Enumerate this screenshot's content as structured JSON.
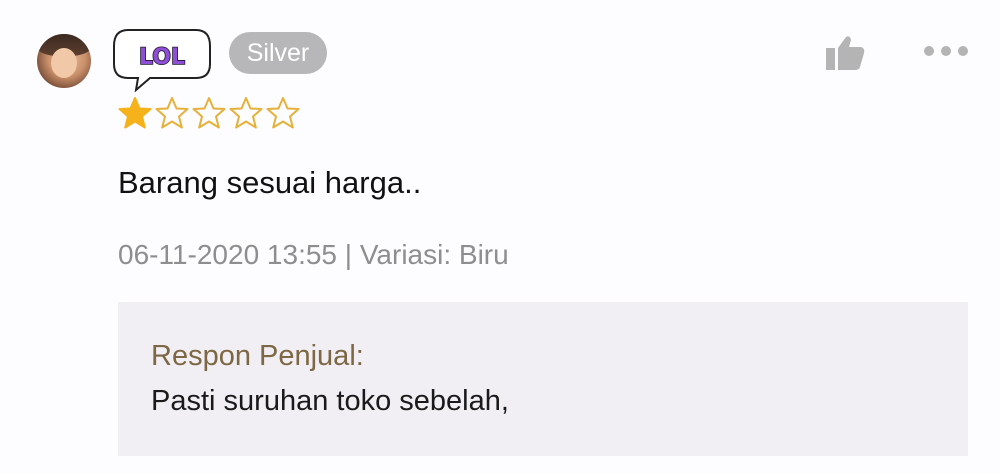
{
  "review": {
    "username_logo_text": "LOL",
    "badge": "Silver",
    "rating": {
      "value": 1,
      "max": 5
    },
    "text": "Barang sesuai harga..",
    "meta": "06-11-2020 13:55 | Variasi: Biru",
    "seller_response": {
      "label": "Respon Penjual:",
      "text": "Pasti suruhan toko sebelah,"
    }
  },
  "colors": {
    "star_filled": "#f5b21a",
    "star_empty_outline": "#e6b13a",
    "logo_purple": "#8e4fd6",
    "badge_bg": "#b7b7b9",
    "response_label": "#7d6744",
    "response_bg": "#f1eff3"
  },
  "icons": [
    "avatar",
    "like-icon",
    "more-icon",
    "star-icon"
  ]
}
